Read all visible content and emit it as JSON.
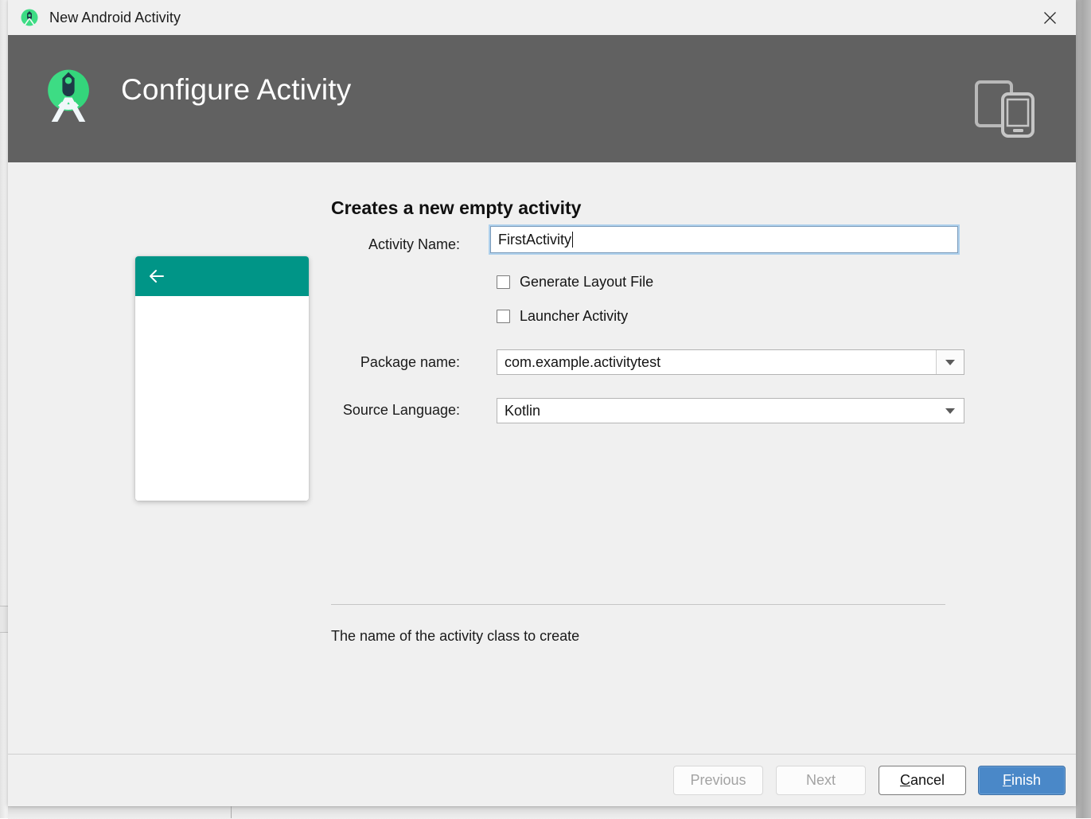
{
  "window": {
    "title": "New Android Activity",
    "app_icon": "android-studio-icon",
    "close_icon": "close-icon"
  },
  "header": {
    "title": "Configure Activity",
    "logo_icon": "android-studio-logo",
    "device_icon": "tablet-phone-icon",
    "background_color": "#616161"
  },
  "main": {
    "section_title": "Creates a new empty activity",
    "preview": {
      "appbar_color": "#009587",
      "back_icon": "back-arrow-icon"
    },
    "fields": {
      "activity_name": {
        "label": "Activity Name:",
        "value": "FirstActivity"
      },
      "package_name": {
        "label": "Package name:",
        "value": "com.example.activitytest",
        "arrow_icon": "chevron-down-icon"
      },
      "source_language": {
        "label": "Source Language:",
        "value": "Kotlin",
        "arrow_icon": "chevron-down-icon"
      }
    },
    "checkboxes": [
      {
        "label": "Generate Layout File",
        "checked": false
      },
      {
        "label": "Launcher Activity",
        "checked": false
      }
    ],
    "helper_text": "The name of the activity class to create"
  },
  "footer": {
    "buttons": [
      {
        "label": "Previous",
        "state": "disabled"
      },
      {
        "label": "Next",
        "state": "disabled"
      },
      {
        "label": "Cancel",
        "state": "enabled",
        "mnemonic": "C"
      },
      {
        "label": "Finish",
        "state": "primary",
        "mnemonic": "F",
        "color": "#4a88c8"
      }
    ]
  }
}
